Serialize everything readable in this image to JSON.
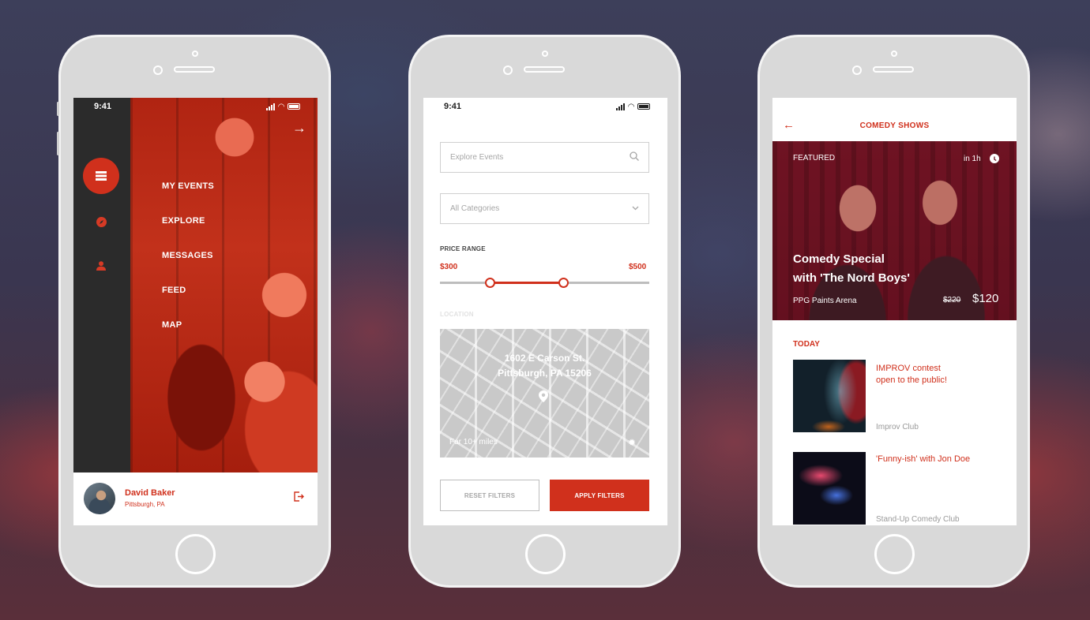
{
  "screen1": {
    "time": "9:41",
    "menu": [
      "MY EVENTS",
      "EXPLORE",
      "MESSAGES",
      "FEED",
      "MAP"
    ],
    "user": {
      "name": "David Baker",
      "location": "Pittsburgh, PA"
    },
    "icons": [
      "list-icon",
      "compass-icon",
      "user-icon",
      "arrow-right-icon",
      "logout-icon"
    ]
  },
  "screen2": {
    "time": "9:41",
    "search_placeholder": "Explore Events",
    "category": "All Categories",
    "price_label": "PRICE RANGE",
    "price_min": "$300",
    "price_max": "$500",
    "location_label": "LOCATION",
    "address_line1": "1602 E Carson St.",
    "address_line2": "Pittsburgh, PA 15206",
    "distance": "Far 10+ miles",
    "reset_label": "RESET FILTERS",
    "apply_label": "APPLY FILTERS"
  },
  "screen3": {
    "title": "COMEDY SHOWS",
    "featured": {
      "label": "FEATURED",
      "time": "in 1h",
      "title_line1": "Comedy Special",
      "title_line2": "with 'The Nord Boys'",
      "venue": "PPG Paints Arena",
      "old_price": "$220",
      "new_price": "$120"
    },
    "today_label": "TODAY",
    "events": [
      {
        "title_line1": "IMPROV contest",
        "title_line2": "open to the public!",
        "venue": "Improv Club"
      },
      {
        "title_line1": "'Funny-ish' with Jon Doe",
        "title_line2": "",
        "venue": "Stand-Up Comedy Club"
      }
    ]
  },
  "colors": {
    "accent": "#d0301c",
    "dark_rail": "#2b2b2b",
    "device": "#d9d9d9"
  }
}
